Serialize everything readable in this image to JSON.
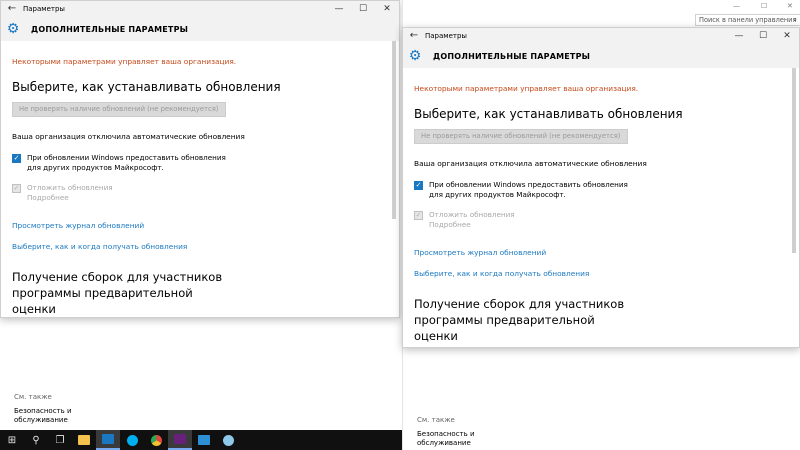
{
  "window": {
    "title": "Параметры",
    "back_icon": "←",
    "minimize_icon": "—",
    "maximize_icon": "☐",
    "close_icon": "✕",
    "header_title": "ДОПОЛНИТЕЛЬНЫЕ ПАРАМЕТРЫ",
    "gear_icon": "⚙"
  },
  "settings": {
    "org_warning": "Некоторыми параметрами управляет ваша организация.",
    "choose_heading": "Выберите, как устанавливать обновления",
    "dropdown_value": "Не проверять наличие обновлений (не рекомендуется)",
    "auto_disabled_note": "Ваша организация отключила автоматические обновления",
    "checkbox_other_products": "При обновлении Windows предоставить обновления для других продуктов Майкрософт.",
    "checkbox_defer": "Отложить обновления",
    "defer_more": "Подробнее",
    "link_history": "Просмотреть журнал обновлений",
    "link_delivery": "Выберите, как и когда получать обновления",
    "insider_heading": "Получение сборок для участников программы предварительной оценки"
  },
  "see_also": {
    "title": "См. также",
    "items": [
      "Безопасность и",
      "обслуживание"
    ]
  },
  "right_background": {
    "minimize_icon": "—",
    "maximize_icon": "☐",
    "close_icon": "✕",
    "search_placeholder": "Поиск в панели управления",
    "search_icon": "🔍"
  },
  "taskbar": {
    "start_icon": "⊞",
    "search_icon": "⚲",
    "taskview_icon": "❐",
    "colors": {
      "explorer": "#f2c14e",
      "settings": "#1a78c2",
      "skype": "#00aff0",
      "chrome": "#e8453c",
      "vs": "#68217a",
      "mail": "#2d8fd5",
      "tool": "#8ec9e8"
    }
  },
  "colors": {
    "accent": "#1a78c2",
    "warning": "#c64a1a"
  }
}
